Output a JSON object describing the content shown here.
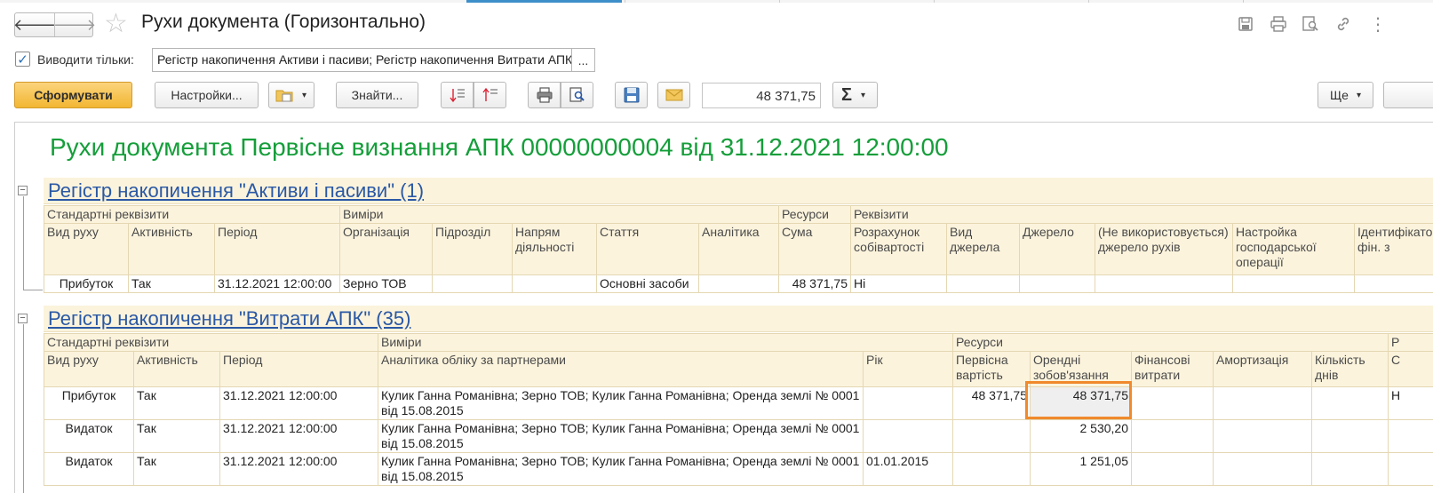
{
  "window": {
    "title": "Рухи документа (Горизонтально)",
    "back_icon": "arrow-left-icon",
    "forward_icon": "arrow-right-icon",
    "favorite_icon": "star-icon",
    "tool_icons": [
      "save-icon",
      "print-icon",
      "preview-icon",
      "link-icon",
      "more-vertical-icon"
    ]
  },
  "filter": {
    "checkbox_label": "Виводити тільки:",
    "checked": true,
    "value": "Регістр накопичення Активи і пасиви; Регістр накопичення Витрати АПК",
    "dots_label": "..."
  },
  "toolbar": {
    "generate_label": "Сформувати",
    "settings_label": "Настройки...",
    "find_label": "Знайти...",
    "amount": "48 371,75",
    "sum_symbol": "Σ",
    "more_label": "Ще",
    "dropdown_arrow": "▾"
  },
  "report": {
    "title": "Рухи документа Первісне визнання АПК 00000000004 від 31.12.2021 12:00:00",
    "section1": {
      "link": "Регістр накопичення \"Активи і пасиви\" (1)",
      "groups": [
        "Стандартні реквізити",
        "Виміри",
        "Ресурси",
        "Реквізити"
      ],
      "columns": [
        "Вид руху",
        "Активність",
        "Період",
        "Організація",
        "Підрозділ",
        "Напрям діяльності",
        "Стаття",
        "Аналітика",
        "Сума",
        "Розрахунок собівартості",
        "Вид джерела",
        "Джерело",
        "(Не використовується) джерело рухів",
        "Настройка господарської операції",
        "Ідентифікатор фін. з"
      ],
      "rows": [
        [
          "Прибуток",
          "Так",
          "31.12.2021 12:00:00",
          "Зерно ТОВ",
          "",
          "",
          "Основні засоби",
          "",
          "48 371,75",
          "Ні",
          "",
          "",
          "",
          "",
          ""
        ]
      ]
    },
    "section2": {
      "link": "Регістр накопичення \"Витрати АПК\" (35)",
      "groups": [
        "Стандартні реквізити",
        "Виміри",
        "Ресурси",
        "Р"
      ],
      "columns": [
        "Вид руху",
        "Активність",
        "Період",
        "Аналітика обліку за партнерами",
        "Рік",
        "Первісна вартість",
        "Орендні зобов'язання",
        "Фінансові витрати",
        "Амортизація",
        "Кількість днів",
        "С"
      ],
      "rows": [
        [
          "Прибуток",
          "Так",
          "31.12.2021 12:00:00",
          "Кулик Ганна Романівна; Зерно ТОВ; Кулик Ганна Романівна; Оренда землі № 0001 від 15.08.2015",
          "",
          "48 371,75",
          "48 371,75",
          "",
          "",
          "",
          "Н"
        ],
        [
          "Видаток",
          "Так",
          "31.12.2021 12:00:00",
          "Кулик Ганна Романівна; Зерно ТОВ; Кулик Ганна Романівна; Оренда землі № 0001 від 15.08.2015",
          "",
          "",
          "2 530,20",
          "",
          "",
          "",
          ""
        ],
        [
          "Видаток",
          "Так",
          "31.12.2021 12:00:00",
          "Кулик Ганна Романівна; Зерно ТОВ; Кулик Ганна Романівна; Оренда землі № 0001 від 15.08.2015",
          "01.01.2015",
          "",
          "1 251,05",
          "",
          "",
          "",
          ""
        ]
      ]
    }
  }
}
